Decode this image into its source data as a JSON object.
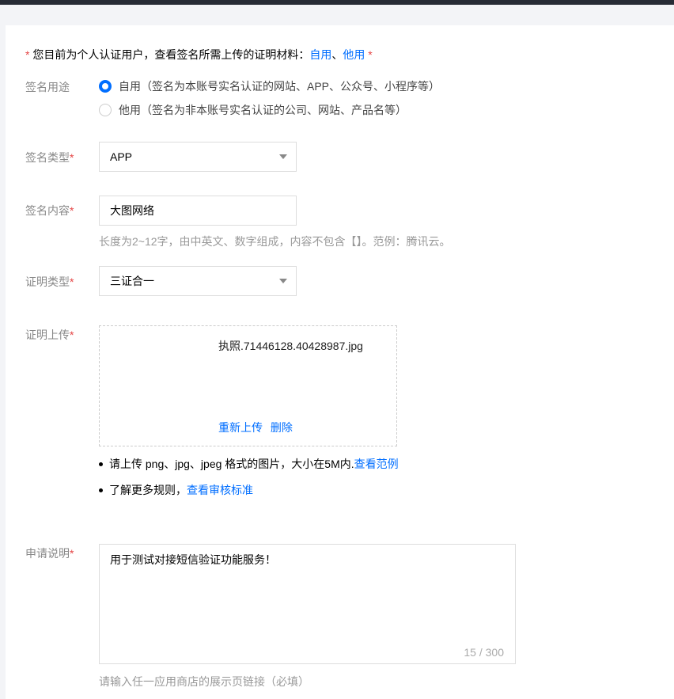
{
  "notice": {
    "star": "*",
    "text": " 您目前为个人认证用户，查看签名所需上传的证明材料：",
    "link_self": "自用",
    "sep": "、",
    "link_other": "他用",
    "star_end": " *"
  },
  "usage": {
    "label": "签名用途",
    "options": [
      {
        "label": "自用（签名为本账号实名认证的网站、APP、公众号、小程序等）",
        "checked": true
      },
      {
        "label": "他用（签名为非本账号实名认证的公司、网站、产品名等）",
        "checked": false
      }
    ]
  },
  "sign_type": {
    "label": "签名类型",
    "star": "*",
    "value": "APP"
  },
  "sign_content": {
    "label": "签名内容",
    "star": "*",
    "value": "大图网络",
    "hint": "长度为2~12字，由中英文、数字组成，内容不包含【】。范例：腾讯云。"
  },
  "cert_type": {
    "label": "证明类型",
    "star": "*",
    "value": "三证合一"
  },
  "cert_upload": {
    "label": "证明上传",
    "star": "*",
    "filename": "执照.71446128.40428987.jpg",
    "reupload": "重新上传",
    "delete": "删除",
    "rule1_text": "请上传 png、jpg、jpeg 格式的图片，大小在5M内.",
    "rule1_link": "查看范例",
    "rule2_text": "了解更多规则，",
    "rule2_link": "查看审核标准"
  },
  "apply_desc": {
    "label": "申请说明",
    "star": "*",
    "value": "用于测试对接短信验证功能服务！",
    "counter": "15 / 300",
    "hint": "请输入任一应用商店的展示页链接（必填）"
  },
  "colors": {
    "accent": "#006eff",
    "required": "#e54545",
    "topbar": "#272b35"
  }
}
